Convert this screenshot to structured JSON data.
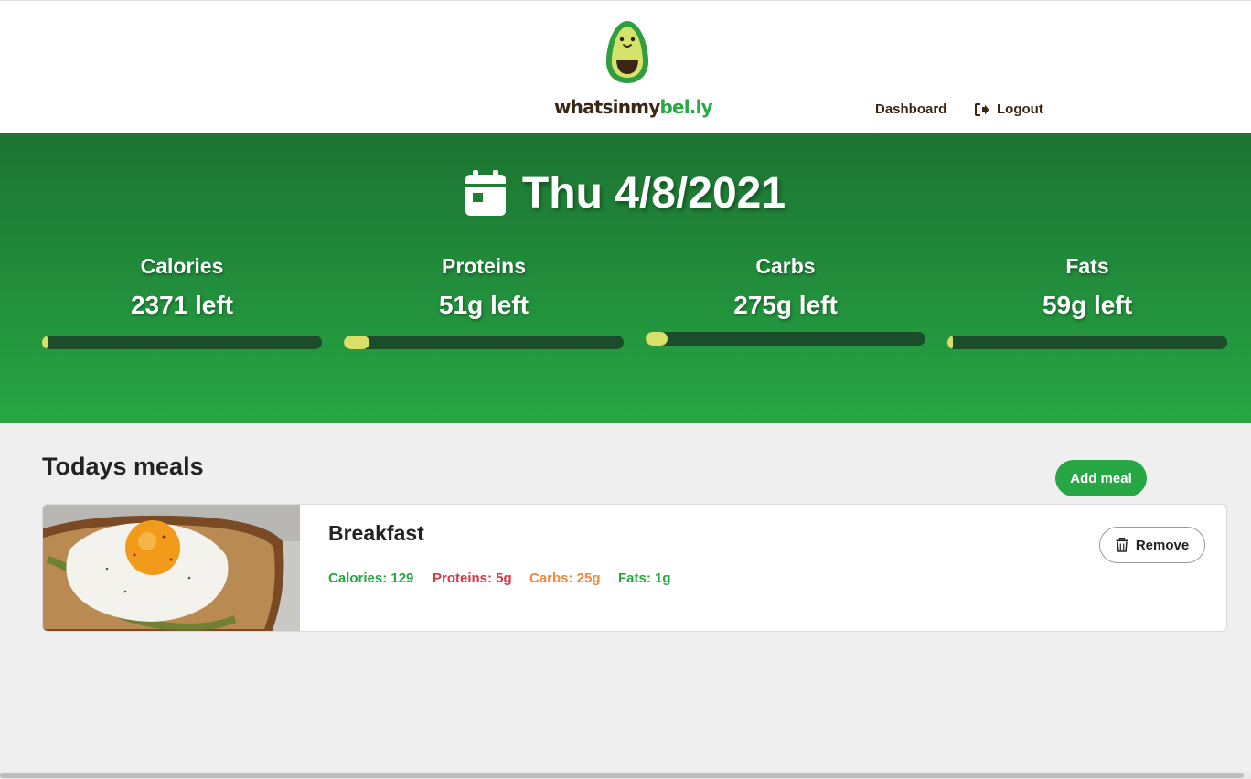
{
  "header": {
    "logo_text_part1": "whatsinmy",
    "logo_text_part2": "bel.ly",
    "nav_dashboard": "Dashboard",
    "nav_logout": "Logout"
  },
  "hero": {
    "date": "Thu 4/8/2021",
    "macros": [
      {
        "label": "Calories",
        "value": "2371 left",
        "progress": 0.02
      },
      {
        "label": "Proteins",
        "value": "51g left",
        "progress": 0.09
      },
      {
        "label": "Carbs",
        "value": "275g left",
        "progress": 0.08
      },
      {
        "label": "Fats",
        "value": "59g left",
        "progress": 0.02
      }
    ]
  },
  "main": {
    "title": "Todays meals",
    "add_meal_label": "Add meal",
    "meals": [
      {
        "name": "Breakfast",
        "calories": "Calories: 129",
        "proteins": "Proteins: 5g",
        "carbs": "Carbs: 25g",
        "fats": "Fats: 1g",
        "remove_label": "Remove"
      }
    ]
  },
  "colors": {
    "brand_green": "#27a644",
    "brand_brown": "#3b2614",
    "hero_top": "#1c7332",
    "bar_track": "#1b4d2a",
    "bar_fill": "#d8e06a",
    "protein_red": "#dc3545",
    "carbs_orange": "#f0883e"
  },
  "icons": {
    "logo": "avocado-icon",
    "logout": "sign-out-icon",
    "date": "calendar-icon",
    "remove": "trash-icon"
  }
}
